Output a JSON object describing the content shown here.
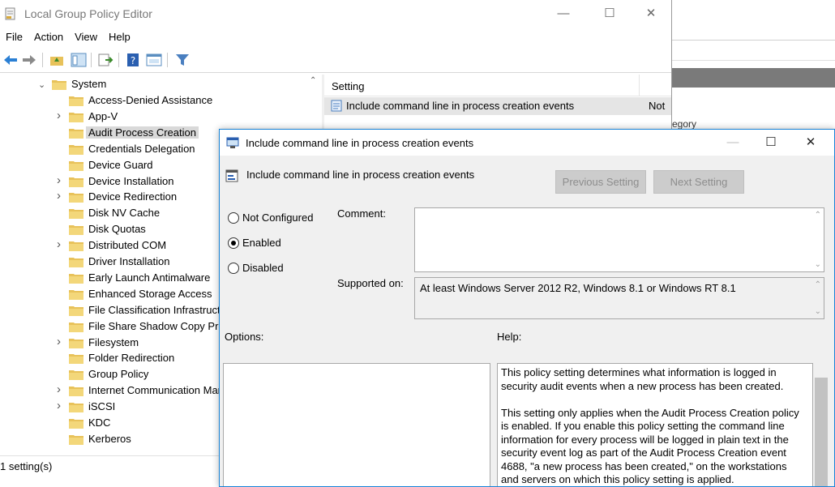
{
  "main_window": {
    "title": "Local Group Policy Editor",
    "controls": {
      "minimize": "—",
      "maximize": "☐",
      "close": "✕"
    },
    "menu": [
      "File",
      "Action",
      "View",
      "Help"
    ],
    "tree": {
      "parent": "System",
      "items": [
        {
          "label": "Access-Denied Assistance",
          "expandable": false
        },
        {
          "label": "App-V",
          "expandable": true
        },
        {
          "label": "Audit Process Creation",
          "expandable": false,
          "selected": true
        },
        {
          "label": "Credentials Delegation",
          "expandable": false
        },
        {
          "label": "Device Guard",
          "expandable": false
        },
        {
          "label": "Device Installation",
          "expandable": true
        },
        {
          "label": "Device Redirection",
          "expandable": true
        },
        {
          "label": "Disk NV Cache",
          "expandable": false
        },
        {
          "label": "Disk Quotas",
          "expandable": false
        },
        {
          "label": "Distributed COM",
          "expandable": true
        },
        {
          "label": "Driver Installation",
          "expandable": false
        },
        {
          "label": "Early Launch Antimalware",
          "expandable": false
        },
        {
          "label": "Enhanced Storage Access",
          "expandable": false
        },
        {
          "label": "File Classification Infrastructure",
          "expandable": false
        },
        {
          "label": "File Share Shadow Copy Provider",
          "expandable": false
        },
        {
          "label": "Filesystem",
          "expandable": true
        },
        {
          "label": "Folder Redirection",
          "expandable": false
        },
        {
          "label": "Group Policy",
          "expandable": false
        },
        {
          "label": "Internet Communication Management",
          "expandable": true
        },
        {
          "label": "iSCSI",
          "expandable": true
        },
        {
          "label": "KDC",
          "expandable": false
        },
        {
          "label": "Kerberos",
          "expandable": false
        }
      ]
    },
    "list": {
      "column_setting": "Setting",
      "rows": [
        {
          "name": "Include command line in process creation events",
          "state": "Not"
        }
      ]
    },
    "status": "1 setting(s)",
    "background_partial": "egory"
  },
  "dialog": {
    "title": "Include command line in process creation events",
    "controls": {
      "minimize": "—",
      "maximize": "☐",
      "close": "✕"
    },
    "heading": "Include command line in process creation events",
    "prev_button": "Previous Setting",
    "next_button": "Next Setting",
    "radios": [
      {
        "label": "Not Configured",
        "checked": false
      },
      {
        "label": "Enabled",
        "checked": true
      },
      {
        "label": "Disabled",
        "checked": false
      }
    ],
    "comment_label": "Comment:",
    "comment_value": "",
    "supported_label": "Supported on:",
    "supported_value": "At least Windows Server 2012 R2, Windows 8.1 or Windows RT 8.1",
    "options_label": "Options:",
    "help_label": "Help:",
    "help_paragraphs": [
      "This policy setting determines what information is logged in security audit events when a new process has been created.",
      "This setting only applies when the Audit Process Creation policy is enabled. If you enable this policy setting the command line information for every process will be logged in plain text in the security event log as part of the Audit Process Creation event 4688, \"a new process has been created,\" on the workstations and servers on which this policy setting is applied."
    ]
  },
  "colors": {
    "accent": "#1883d7",
    "folder": "#e8c25a",
    "selection": "#d9d9d9"
  }
}
